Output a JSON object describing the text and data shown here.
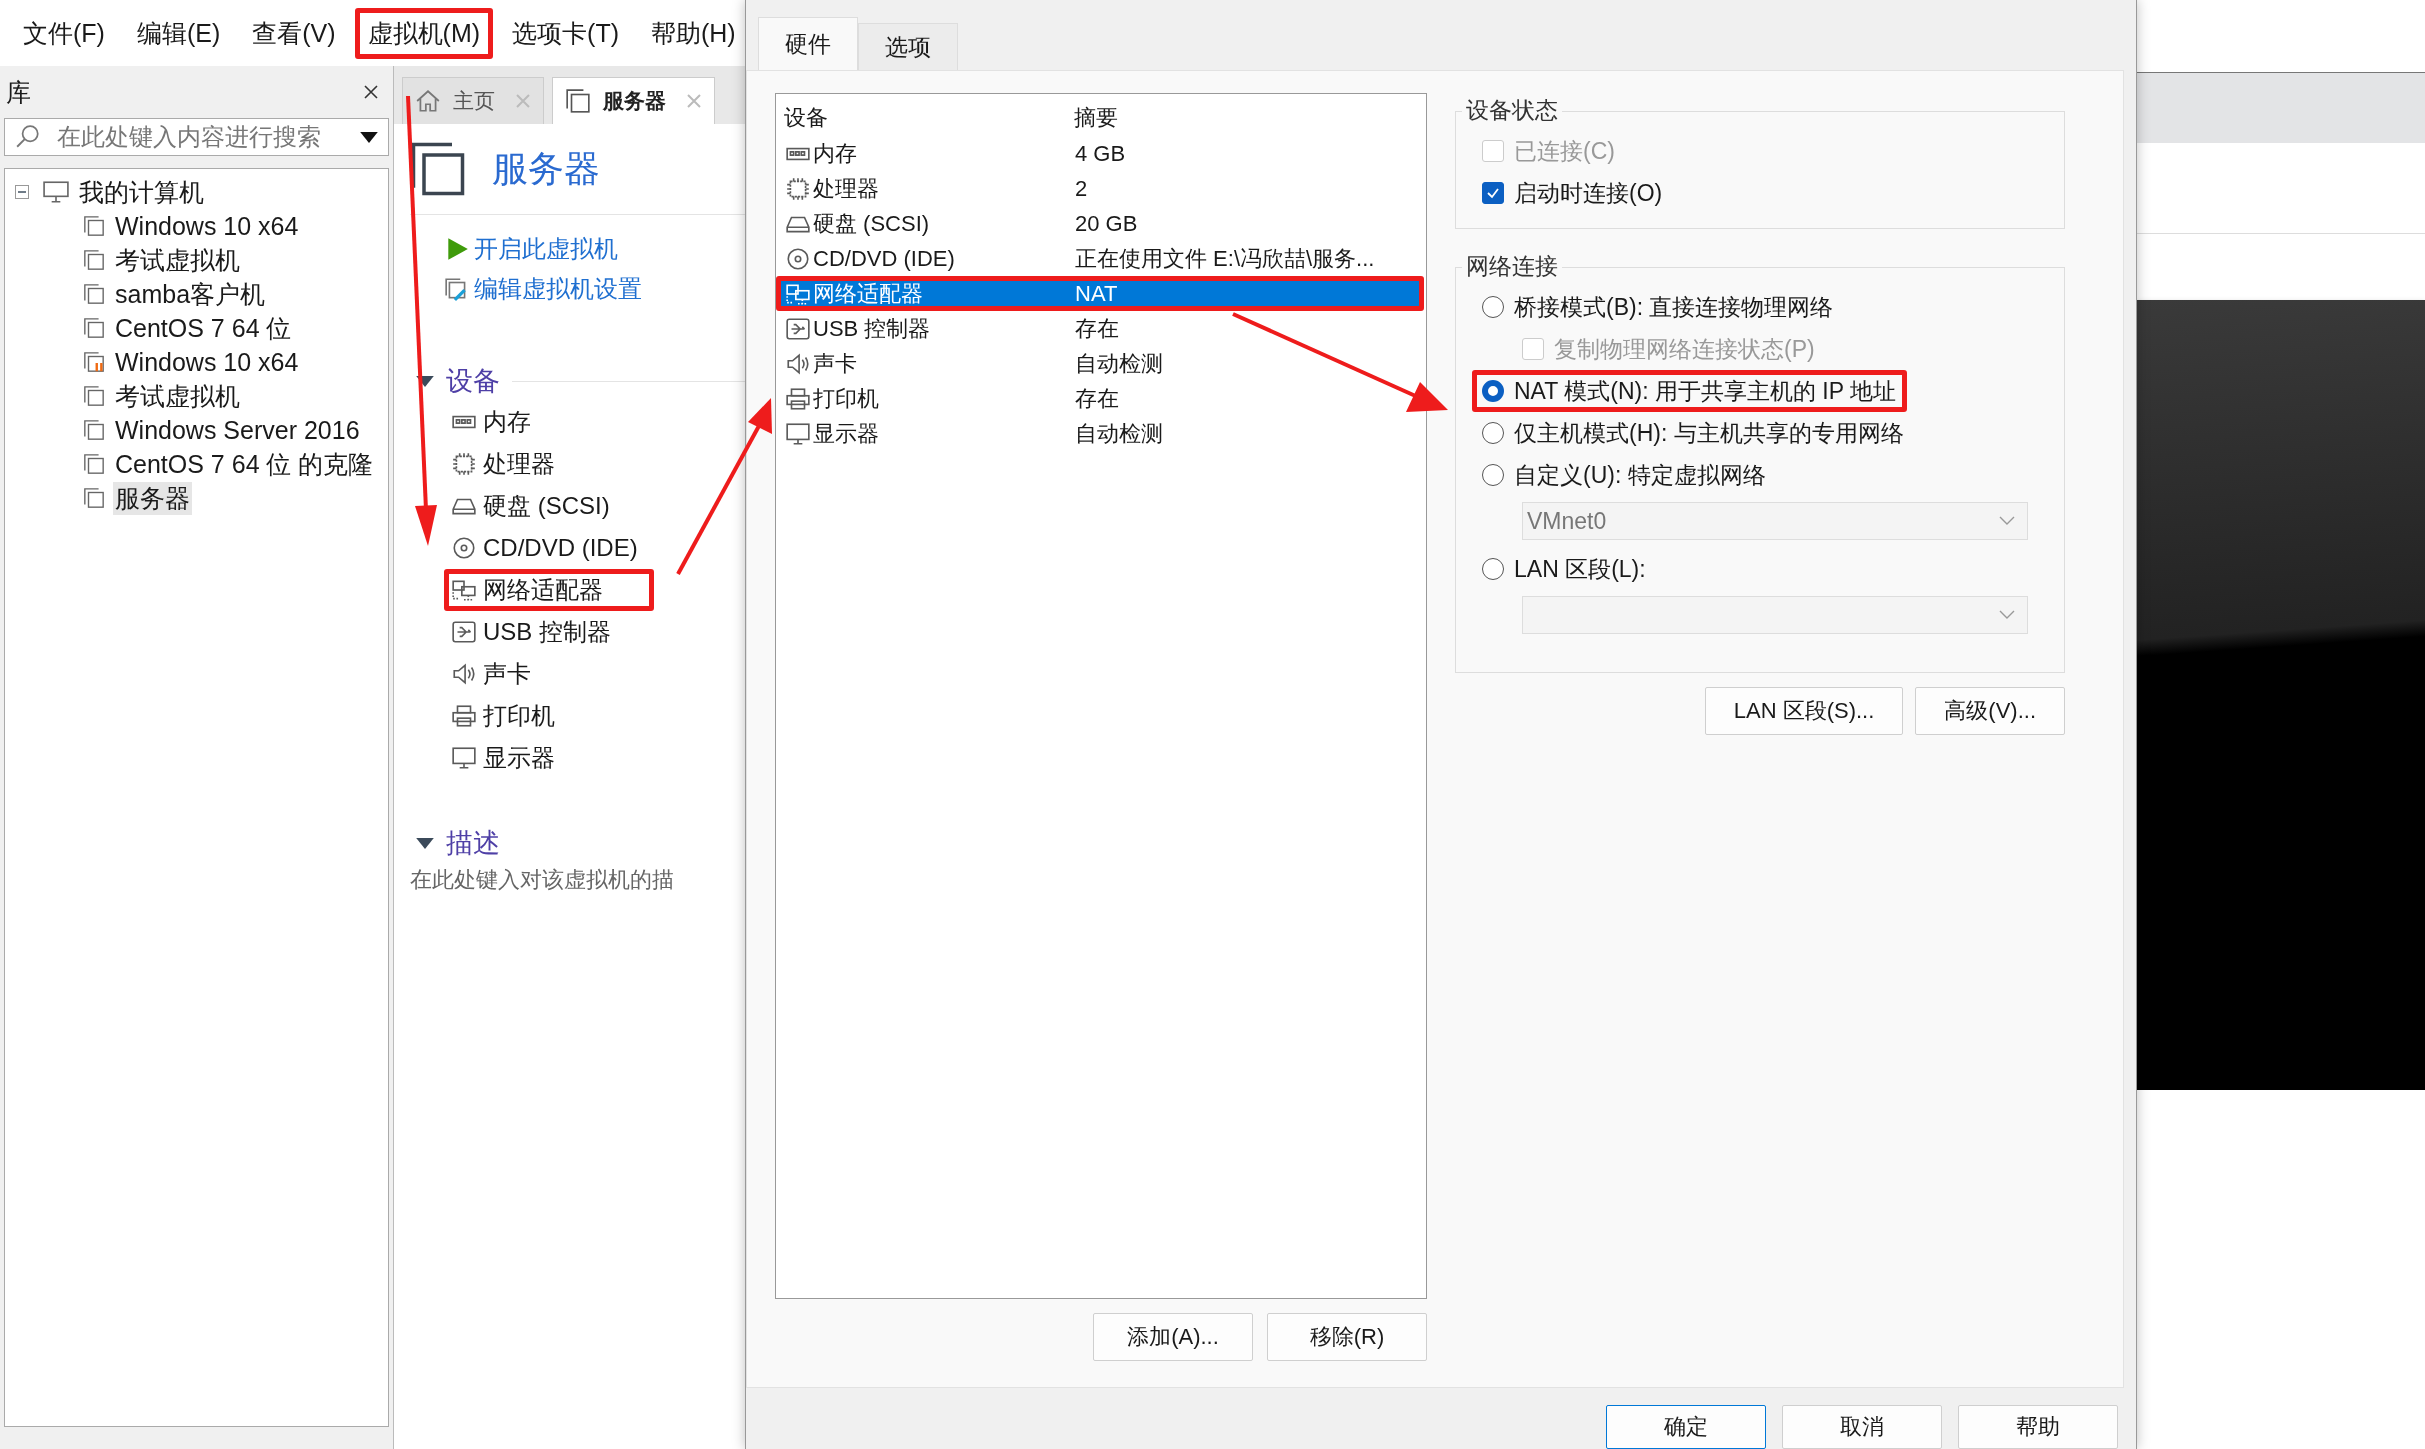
{
  "menu": {
    "items": [
      {
        "label": "文件(F)",
        "highlighted": false
      },
      {
        "label": "编辑(E)",
        "highlighted": false
      },
      {
        "label": "查看(V)",
        "highlighted": false
      },
      {
        "label": "虚拟机(M)",
        "highlighted": true
      },
      {
        "label": "选项卡(T)",
        "highlighted": false
      },
      {
        "label": "帮助(H)",
        "highlighted": false
      }
    ]
  },
  "library": {
    "title": "库",
    "search": {
      "placeholder": "在此处键入内容进行搜索"
    },
    "tree": [
      {
        "label": "我的计算机",
        "expanded": true,
        "children": [
          {
            "label": "Windows 10 x64",
            "suspended": false,
            "selected": false
          },
          {
            "label": "考试虚拟机",
            "suspended": false,
            "selected": false
          },
          {
            "label": "samba客户机",
            "suspended": false,
            "selected": false
          },
          {
            "label": "CentOS 7 64 位",
            "suspended": false,
            "selected": false
          },
          {
            "label": "Windows 10 x64",
            "suspended": true,
            "selected": false
          },
          {
            "label": "考试虚拟机",
            "suspended": false,
            "selected": false
          },
          {
            "label": "Windows Server 2016",
            "suspended": false,
            "selected": false
          },
          {
            "label": "CentOS 7 64 位 的克隆",
            "suspended": false,
            "selected": false
          },
          {
            "label": "服务器",
            "suspended": false,
            "selected": true
          }
        ]
      }
    ]
  },
  "vm_tabs": [
    {
      "label": "主页",
      "kind": "home",
      "selected": false
    },
    {
      "label": "服务器",
      "kind": "vm",
      "selected": true
    }
  ],
  "vm_page": {
    "title": "服务器",
    "actions": [
      {
        "label": "开启此虚拟机",
        "kind": "power-on"
      },
      {
        "label": "编辑虚拟机设置",
        "kind": "edit"
      }
    ],
    "devices_section": {
      "title": "设备",
      "expanded": true,
      "items": [
        {
          "label": "内存",
          "kind": "memory",
          "highlighted": false
        },
        {
          "label": "处理器",
          "kind": "cpu",
          "highlighted": false
        },
        {
          "label": "硬盘 (SCSI)",
          "kind": "disk",
          "highlighted": false
        },
        {
          "label": "CD/DVD (IDE)",
          "kind": "cdrom",
          "highlighted": false
        },
        {
          "label": "网络适配器",
          "kind": "network",
          "highlighted": true
        },
        {
          "label": "USB 控制器",
          "kind": "usb",
          "highlighted": false
        },
        {
          "label": "声卡",
          "kind": "sound",
          "highlighted": false
        },
        {
          "label": "打印机",
          "kind": "printer",
          "highlighted": false
        },
        {
          "label": "显示器",
          "kind": "display",
          "highlighted": false
        }
      ]
    },
    "description_section": {
      "title": "描述",
      "expanded": true,
      "text": "在此处键入对该虚拟机的描"
    }
  },
  "dialog": {
    "tabs": [
      {
        "label": "硬件",
        "selected": true
      },
      {
        "label": "选项",
        "selected": false
      }
    ],
    "device_table": {
      "columns": [
        "设备",
        "摘要"
      ],
      "rows": [
        {
          "device": "内存",
          "kind": "memory",
          "summary": "4 GB",
          "selected": false,
          "highlighted": false
        },
        {
          "device": "处理器",
          "kind": "cpu",
          "summary": "2",
          "selected": false,
          "highlighted": false
        },
        {
          "device": "硬盘 (SCSI)",
          "kind": "disk",
          "summary": "20 GB",
          "selected": false,
          "highlighted": false
        },
        {
          "device": "CD/DVD (IDE)",
          "kind": "cdrom",
          "summary": "正在使用文件 E:\\冯欣喆\\服务...",
          "selected": false,
          "highlighted": false
        },
        {
          "device": "网络适配器",
          "kind": "network",
          "summary": "NAT",
          "selected": true,
          "highlighted": true
        },
        {
          "device": "USB 控制器",
          "kind": "usb",
          "summary": "存在",
          "selected": false,
          "highlighted": false
        },
        {
          "device": "声卡",
          "kind": "sound",
          "summary": "自动检测",
          "selected": false,
          "highlighted": false
        },
        {
          "device": "打印机",
          "kind": "printer",
          "summary": "存在",
          "selected": false,
          "highlighted": false
        },
        {
          "device": "显示器",
          "kind": "display",
          "summary": "自动检测",
          "selected": false,
          "highlighted": false
        }
      ]
    },
    "list_buttons": [
      "添加(A)...",
      "移除(R)"
    ],
    "device_status": {
      "title": "设备状态",
      "options": [
        {
          "label": "已连接(C)",
          "checked": false,
          "disabled": true
        },
        {
          "label": "启动时连接(O)",
          "checked": true,
          "disabled": false
        }
      ]
    },
    "network": {
      "title": "网络连接",
      "options": [
        {
          "kind": "radio",
          "label": "桥接模式(B): 直接连接物理网络",
          "selected": false,
          "highlighted": false
        },
        {
          "kind": "checkbox",
          "label": "复制物理网络连接状态(P)",
          "checked": false,
          "disabled": true
        },
        {
          "kind": "radio",
          "label": "NAT 模式(N): 用于共享主机的 IP 地址",
          "selected": true,
          "highlighted": true
        },
        {
          "kind": "radio",
          "label": "仅主机模式(H): 与主机共享的专用网络",
          "selected": false,
          "highlighted": false
        },
        {
          "kind": "radio",
          "label": "自定义(U): 特定虚拟网络",
          "selected": false,
          "highlighted": false
        },
        {
          "kind": "select",
          "value": "VMnet0",
          "disabled": true
        },
        {
          "kind": "radio",
          "label": "LAN 区段(L):",
          "selected": false,
          "highlighted": false
        },
        {
          "kind": "select",
          "disabled": true
        }
      ]
    },
    "network_buttons": [
      "LAN 区段(S)...",
      "高级(V)..."
    ],
    "footer_buttons": [
      {
        "label": "确定",
        "default": true
      },
      {
        "label": "取消",
        "default": false
      },
      {
        "label": "帮助",
        "default": false
      }
    ]
  }
}
